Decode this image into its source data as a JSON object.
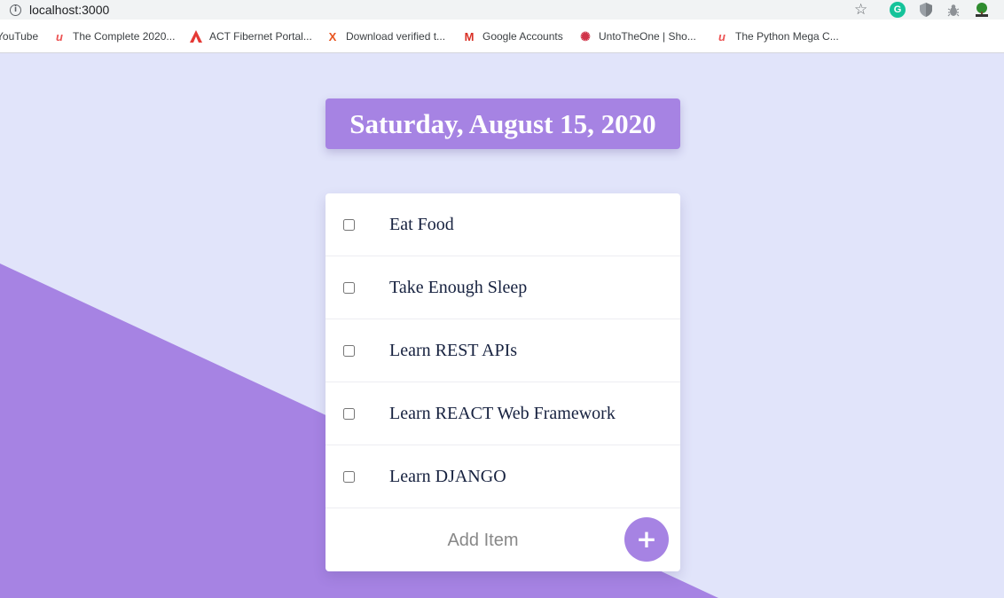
{
  "browser": {
    "url": "localhost:3000",
    "bookmarks": [
      {
        "label": "YouTube",
        "icon": ""
      },
      {
        "label": "The Complete 2020...",
        "icon": "u"
      },
      {
        "label": "ACT Fibernet Portal...",
        "icon": "A"
      },
      {
        "label": "Download verified t...",
        "icon": "X"
      },
      {
        "label": "Google Accounts",
        "icon": "M"
      },
      {
        "label": "UntoTheOne | Sho...",
        "icon": "✺"
      },
      {
        "label": "The Python Mega C...",
        "icon": "u"
      }
    ],
    "extensions": {
      "grammarly": "G"
    }
  },
  "header": {
    "date": "Saturday, August 15, 2020"
  },
  "todo": {
    "items": [
      {
        "label": "Eat Food",
        "checked": false
      },
      {
        "label": "Take Enough Sleep",
        "checked": false
      },
      {
        "label": "Learn REST APIs",
        "checked": false
      },
      {
        "label": "Learn REACT Web Framework",
        "checked": false
      },
      {
        "label": "Learn DJANGO",
        "checked": false
      }
    ],
    "add_placeholder": "Add Item",
    "add_button_label": "+"
  },
  "colors": {
    "background": "#e1e4fa",
    "accent": "#a683e3",
    "text": "#16213f"
  }
}
